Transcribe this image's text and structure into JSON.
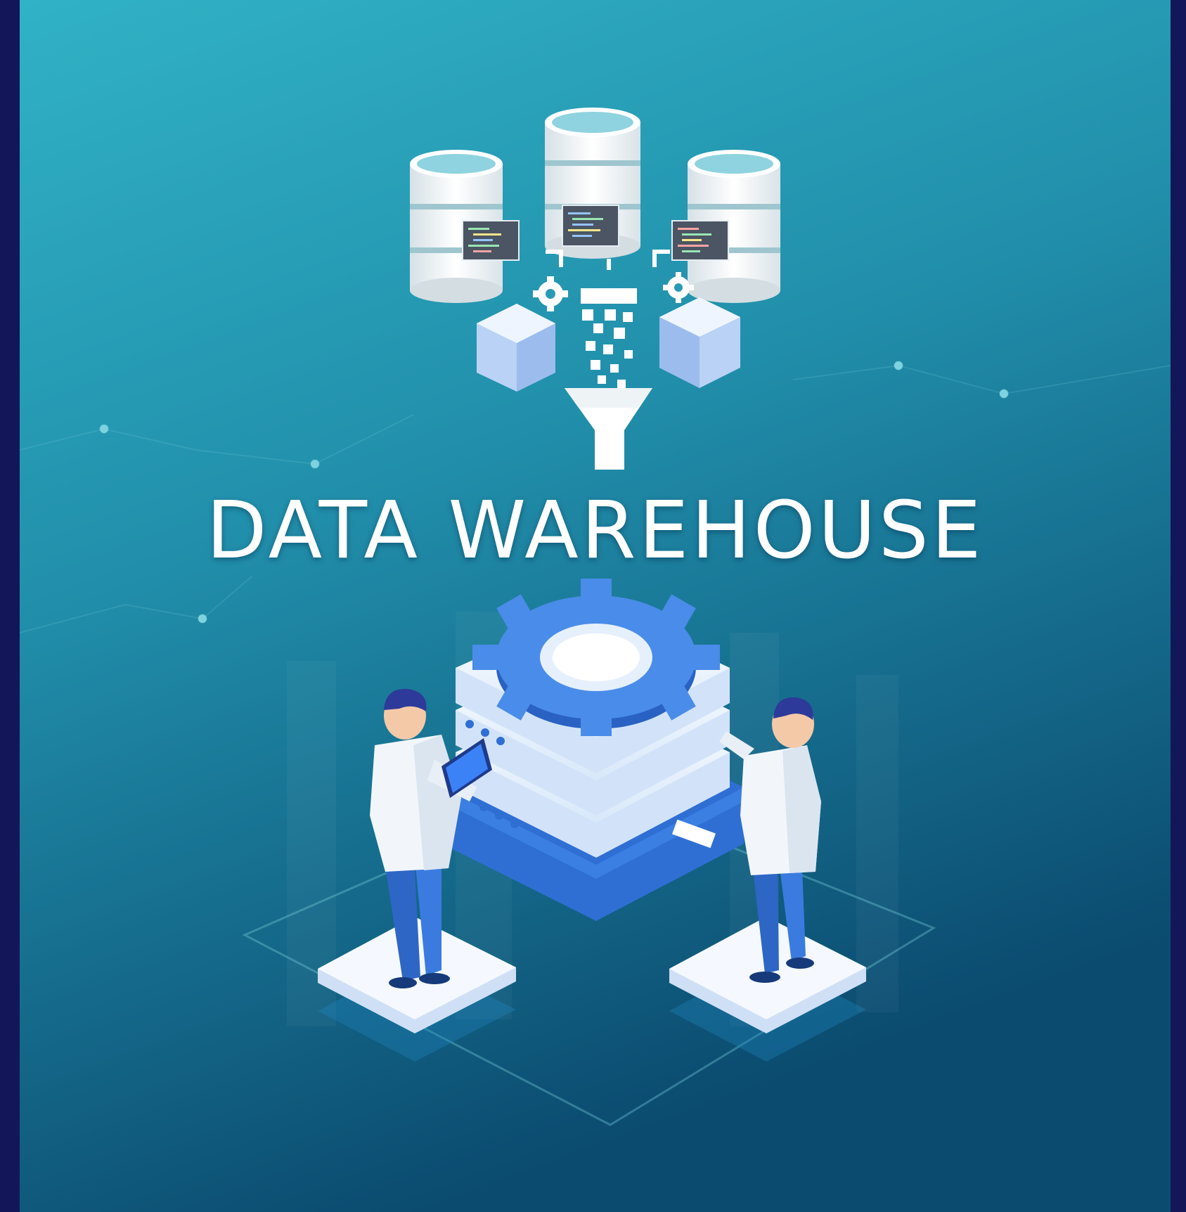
{
  "title": "DATA WAREHOUSE",
  "colors": {
    "frame": "#13175a",
    "background_top": "#2fb0c4",
    "background_bottom": "#0c4f72",
    "accent": "#3e7fe6",
    "surface": "#eaf4fd"
  },
  "icons": [
    "database-icon",
    "code-snippet-icon",
    "gear-icon",
    "cube-icon",
    "funnel-icon",
    "server-stack-icon",
    "engineer-figure",
    "tablet-icon"
  ]
}
